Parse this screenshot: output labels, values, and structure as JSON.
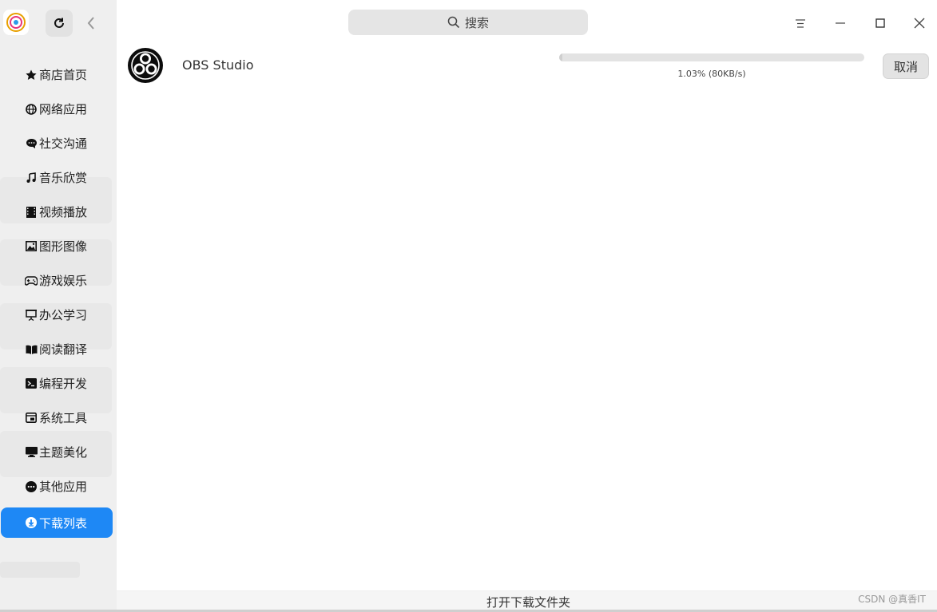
{
  "sidebar": {
    "refresh_label": "",
    "nav": [
      {
        "label": "商店首页",
        "icon": "star-icon"
      },
      {
        "label": "网络应用",
        "icon": "globe-icon"
      },
      {
        "label": "社交沟通",
        "icon": "chat-icon"
      },
      {
        "label": "音乐欣赏",
        "icon": "music-note-icon"
      },
      {
        "label": "视频播放",
        "icon": "film-icon"
      },
      {
        "label": "图形图像",
        "icon": "image-icon"
      },
      {
        "label": "游戏娱乐",
        "icon": "gamepad-icon"
      },
      {
        "label": "办公学习",
        "icon": "presentation-icon"
      },
      {
        "label": "阅读翻译",
        "icon": "book-icon"
      },
      {
        "label": "编程开发",
        "icon": "terminal-icon"
      },
      {
        "label": "系统工具",
        "icon": "toolbox-icon"
      },
      {
        "label": "主题美化",
        "icon": "monitor-icon"
      },
      {
        "label": "其他应用",
        "icon": "more-icon"
      },
      {
        "label": "下载列表",
        "icon": "download-icon",
        "active": true
      }
    ]
  },
  "header": {
    "search_label": "搜索"
  },
  "download": {
    "app_name": "OBS Studio",
    "progress_text": "1.03% (80KB/s)",
    "progress_fraction": 0.0103,
    "cancel_label": "取消"
  },
  "footer": {
    "open_folder_label": "打开下载文件夹",
    "watermark": "CSDN @真香IT"
  },
  "colors": {
    "accent": "#1e88f5",
    "sidebar_bg": "#efefef"
  }
}
